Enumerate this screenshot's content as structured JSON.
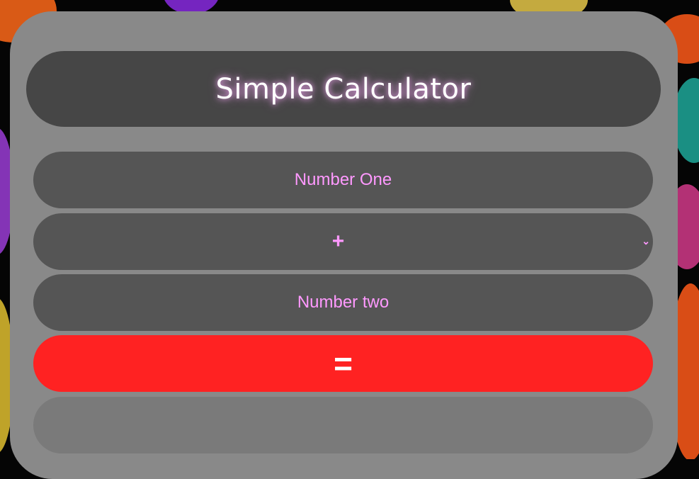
{
  "calculator": {
    "title": "Simple Calculator",
    "number_one_placeholder": "Number One",
    "operator_selected": "+",
    "number_two_placeholder": "Number two",
    "equals_label": "=",
    "result_value": ""
  },
  "colors": {
    "card": "#898989",
    "title_bar": "#464646",
    "field": "#555555",
    "field_text": "#ff99ff",
    "equals_button": "#ff2222",
    "result_field": "#7a7a7a"
  },
  "icons": {
    "operator_dropdown": "chevron-down-icon"
  }
}
